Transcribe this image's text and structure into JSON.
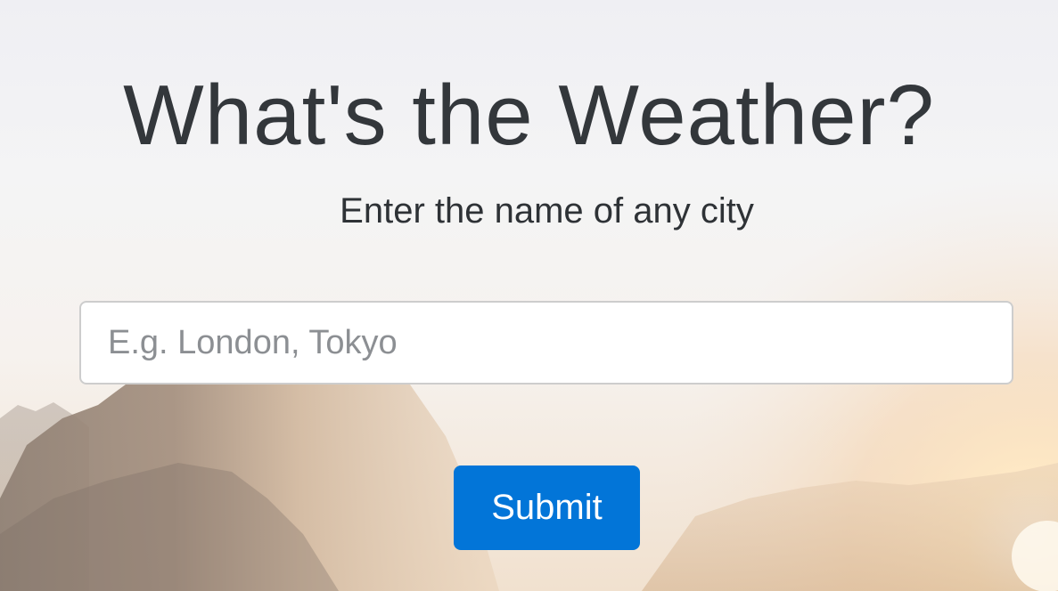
{
  "page": {
    "title": "What's the Weather?",
    "subtitle": "Enter the name of any city"
  },
  "search": {
    "value": "",
    "placeholder": "E.g. London, Tokyo"
  },
  "actions": {
    "submit_label": "Submit"
  },
  "colors": {
    "accent": "#0275d8",
    "heading": "#33373b",
    "input_border": "#cdcdcd"
  },
  "background": {
    "description_icon": "mountain-sunrise-background"
  }
}
